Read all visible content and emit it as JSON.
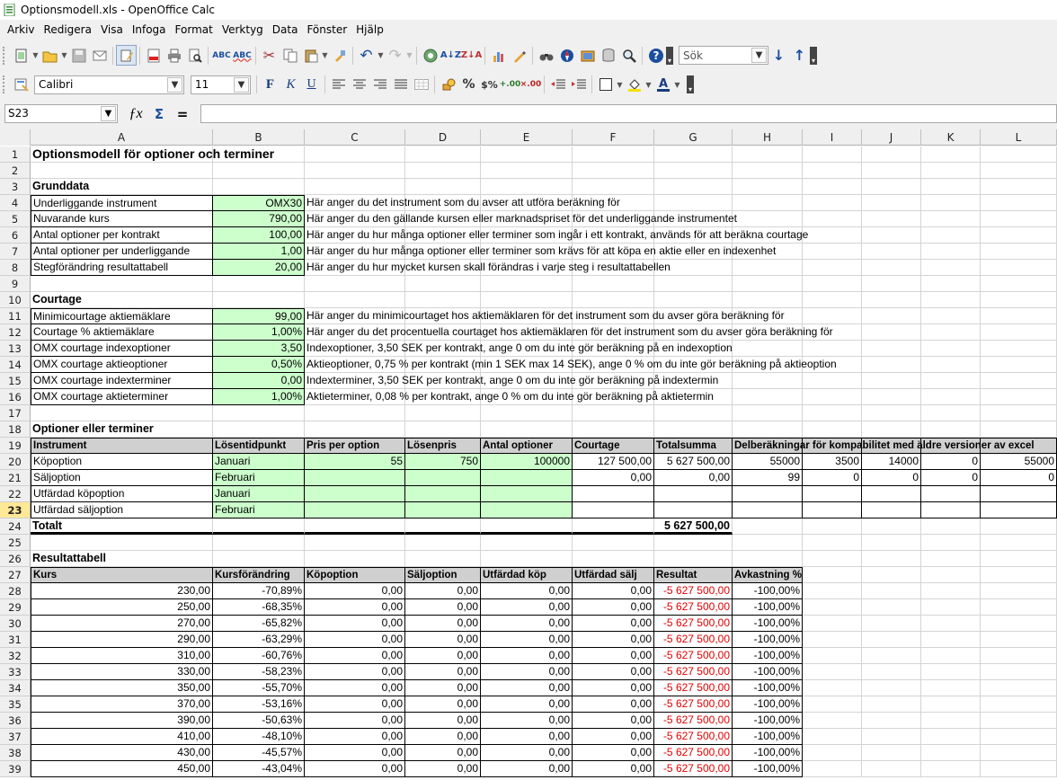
{
  "window": {
    "title": "Optionsmodell.xls - OpenOffice Calc"
  },
  "menu": [
    "Arkiv",
    "Redigera",
    "Visa",
    "Infoga",
    "Format",
    "Verktyg",
    "Data",
    "Fönster",
    "Hjälp"
  ],
  "toolbar": {
    "search_placeholder": "Sök",
    "font_name": "Calibri",
    "font_size": "11",
    "bold": "F",
    "italic": "K",
    "underline": "U"
  },
  "formula": {
    "cell_ref": "S23",
    "content": ""
  },
  "columns": [
    "A",
    "B",
    "C",
    "D",
    "E",
    "F",
    "G",
    "H",
    "I",
    "J",
    "K",
    "L"
  ],
  "active_row": "23",
  "rows": [
    {
      "n": "1",
      "cells": {
        "A": "Optionsmodell för optioner och terminer"
      }
    },
    {
      "n": "2",
      "cells": {}
    },
    {
      "n": "3",
      "cells": {
        "A": "Grunddata"
      }
    },
    {
      "n": "4",
      "cells": {
        "A": "Underliggande instrument",
        "B": "OMX30",
        "C": "Här anger du det instrument som du avser att utföra beräkning för"
      }
    },
    {
      "n": "5",
      "cells": {
        "A": "Nuvarande kurs",
        "B": "790,00",
        "C": "Här anger du den gällande kursen eller marknadspriset för det underliggande instrumentet"
      }
    },
    {
      "n": "6",
      "cells": {
        "A": "Antal optioner per kontrakt",
        "B": "100,00",
        "C": "Här anger du hur många optioner eller terminer som ingår i ett kontrakt, används för att beräkna courtage"
      }
    },
    {
      "n": "7",
      "cells": {
        "A": "Antal optioner per underliggande",
        "B": "1,00",
        "C": "Här anger du hur många optioner eller terminer som krävs för att köpa en aktie eller en indexenhet"
      }
    },
    {
      "n": "8",
      "cells": {
        "A": "Stegförändring resultattabell",
        "B": "20,00",
        "C": "Här anger du hur mycket kursen skall förändras i varje steg i resultattabellen"
      }
    },
    {
      "n": "9",
      "cells": {}
    },
    {
      "n": "10",
      "cells": {
        "A": "Courtage"
      }
    },
    {
      "n": "11",
      "cells": {
        "A": "Minimicourtage aktiemäklare",
        "B": "99,00",
        "C": "Här anger du minimicourtaget hos aktiemäklaren för det instrument som du avser göra beräkning för"
      }
    },
    {
      "n": "12",
      "cells": {
        "A": "Courtage % aktiemäklare",
        "B": "1,00%",
        "C": "Här anger du det procentuella courtaget hos aktiemäklaren för det instrument som du avser göra beräkning för"
      }
    },
    {
      "n": "13",
      "cells": {
        "A": "OMX courtage indexoptioner",
        "B": "3,50",
        "C": "Indexoptioner, 3,50 SEK per kontrakt, ange 0 om du inte gör beräkning på en indexoption"
      }
    },
    {
      "n": "14",
      "cells": {
        "A": "OMX courtage aktieoptioner",
        "B": "0,50%",
        "C": "Aktieoptioner, 0,75 % per kontrakt (min 1 SEK max 14 SEK), ange 0 % om du inte gör beräkning på aktieoption"
      }
    },
    {
      "n": "15",
      "cells": {
        "A": "OMX courtage indexterminer",
        "B": "0,00",
        "C": "Indexterminer, 3,50 SEK per kontrakt, ange 0 om du inte gör beräkning på indextermin"
      }
    },
    {
      "n": "16",
      "cells": {
        "A": "OMX courtage aktieterminer",
        "B": "1,00%",
        "C": "Aktieterminer, 0,08 % per kontrakt, ange 0 % om du inte gör beräkning på aktietermin"
      }
    },
    {
      "n": "17",
      "cells": {}
    },
    {
      "n": "18",
      "cells": {
        "A": "Optioner eller terminer"
      }
    },
    {
      "n": "19",
      "cells": {
        "A": "Instrument",
        "B": "Lösentidpunkt",
        "C": "Pris per option",
        "D": "Lösenpris",
        "E": "Antal optioner",
        "F": "Courtage",
        "G": "Totalsumma",
        "H": "Delberäkningar för kompabilitet med äldre versioner av excel"
      }
    },
    {
      "n": "20",
      "cells": {
        "A": "Köpoption",
        "B": "Januari",
        "C": "55",
        "D": "750",
        "E": "100000",
        "F": "127 500,00",
        "G": "5 627 500,00",
        "H": "55000",
        "I": "3500",
        "J": "14000",
        "K": "0",
        "L": "55000"
      }
    },
    {
      "n": "21",
      "cells": {
        "A": "Säljoption",
        "B": "Februari",
        "F": "0,00",
        "G": "0,00",
        "H": "99",
        "I": "0",
        "J": "0",
        "K": "0",
        "L": "0"
      }
    },
    {
      "n": "22",
      "cells": {
        "A": "Utfärdad köpoption",
        "B": "Januari"
      }
    },
    {
      "n": "23",
      "cells": {
        "A": "Utfärdad säljoption",
        "B": "Februari"
      }
    },
    {
      "n": "24",
      "cells": {
        "A": "Totalt",
        "G": "5 627 500,00"
      }
    },
    {
      "n": "25",
      "cells": {}
    },
    {
      "n": "26",
      "cells": {
        "A": "Resultattabell"
      }
    },
    {
      "n": "27",
      "cells": {
        "A": "Kurs",
        "B": "Kursförändring",
        "C": "Köpoption",
        "D": "Säljoption",
        "E": "Utfärdad köp",
        "F": "Utfärdad sälj",
        "G": "Resultat",
        "H": "Avkastning %"
      }
    },
    {
      "n": "28",
      "cells": {
        "A": "230,00",
        "B": "-70,89%",
        "C": "0,00",
        "D": "0,00",
        "E": "0,00",
        "F": "0,00",
        "G": "-5 627 500,00",
        "H": "-100,00%"
      }
    },
    {
      "n": "29",
      "cells": {
        "A": "250,00",
        "B": "-68,35%",
        "C": "0,00",
        "D": "0,00",
        "E": "0,00",
        "F": "0,00",
        "G": "-5 627 500,00",
        "H": "-100,00%"
      }
    },
    {
      "n": "30",
      "cells": {
        "A": "270,00",
        "B": "-65,82%",
        "C": "0,00",
        "D": "0,00",
        "E": "0,00",
        "F": "0,00",
        "G": "-5 627 500,00",
        "H": "-100,00%"
      }
    },
    {
      "n": "31",
      "cells": {
        "A": "290,00",
        "B": "-63,29%",
        "C": "0,00",
        "D": "0,00",
        "E": "0,00",
        "F": "0,00",
        "G": "-5 627 500,00",
        "H": "-100,00%"
      }
    },
    {
      "n": "32",
      "cells": {
        "A": "310,00",
        "B": "-60,76%",
        "C": "0,00",
        "D": "0,00",
        "E": "0,00",
        "F": "0,00",
        "G": "-5 627 500,00",
        "H": "-100,00%"
      }
    },
    {
      "n": "33",
      "cells": {
        "A": "330,00",
        "B": "-58,23%",
        "C": "0,00",
        "D": "0,00",
        "E": "0,00",
        "F": "0,00",
        "G": "-5 627 500,00",
        "H": "-100,00%"
      }
    },
    {
      "n": "34",
      "cells": {
        "A": "350,00",
        "B": "-55,70%",
        "C": "0,00",
        "D": "0,00",
        "E": "0,00",
        "F": "0,00",
        "G": "-5 627 500,00",
        "H": "-100,00%"
      }
    },
    {
      "n": "35",
      "cells": {
        "A": "370,00",
        "B": "-53,16%",
        "C": "0,00",
        "D": "0,00",
        "E": "0,00",
        "F": "0,00",
        "G": "-5 627 500,00",
        "H": "-100,00%"
      }
    },
    {
      "n": "36",
      "cells": {
        "A": "390,00",
        "B": "-50,63%",
        "C": "0,00",
        "D": "0,00",
        "E": "0,00",
        "F": "0,00",
        "G": "-5 627 500,00",
        "H": "-100,00%"
      }
    },
    {
      "n": "37",
      "cells": {
        "A": "410,00",
        "B": "-48,10%",
        "C": "0,00",
        "D": "0,00",
        "E": "0,00",
        "F": "0,00",
        "G": "-5 627 500,00",
        "H": "-100,00%"
      }
    },
    {
      "n": "38",
      "cells": {
        "A": "430,00",
        "B": "-45,57%",
        "C": "0,00",
        "D": "0,00",
        "E": "0,00",
        "F": "0,00",
        "G": "-5 627 500,00",
        "H": "-100,00%"
      }
    },
    {
      "n": "39",
      "cells": {
        "A": "450,00",
        "B": "-43,04%",
        "C": "0,00",
        "D": "0,00",
        "E": "0,00",
        "F": "0,00",
        "G": "-5 627 500,00",
        "H": "-100,00%"
      }
    }
  ],
  "colors": {
    "input_green": "#ccffcc",
    "header_gray": "#d0d0d0",
    "negative_red": "#e00000",
    "active_row": "#ffe896"
  }
}
